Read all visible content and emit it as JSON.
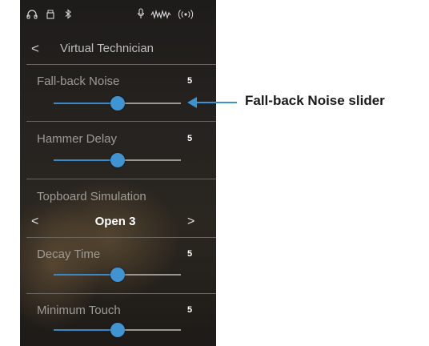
{
  "status_bar": {
    "icons": [
      "headphones-icon",
      "usb-icon",
      "bluetooth-icon",
      "microphone-icon",
      "sound-wave-icon",
      "wireless-icon"
    ]
  },
  "header": {
    "back_glyph": "<",
    "title": "Virtual Technician"
  },
  "rows": [
    {
      "label": "Fall-back Noise",
      "value": "5",
      "level": 0.5
    },
    {
      "label": "Hammer Delay",
      "value": "5",
      "level": 0.5
    },
    {
      "label": "Decay Time",
      "value": "5",
      "level": 0.5
    },
    {
      "label": "Minimum Touch",
      "value": "5",
      "level": 0.5
    }
  ],
  "selector": {
    "label": "Topboard Simulation",
    "value": "Open 3",
    "prev_glyph": "<",
    "next_glyph": ">"
  },
  "callout": {
    "text": "Fall-back Noise slider"
  },
  "colors": {
    "accent": "#3f94d1",
    "background": "#231f1c",
    "label": "#9e9a96"
  }
}
